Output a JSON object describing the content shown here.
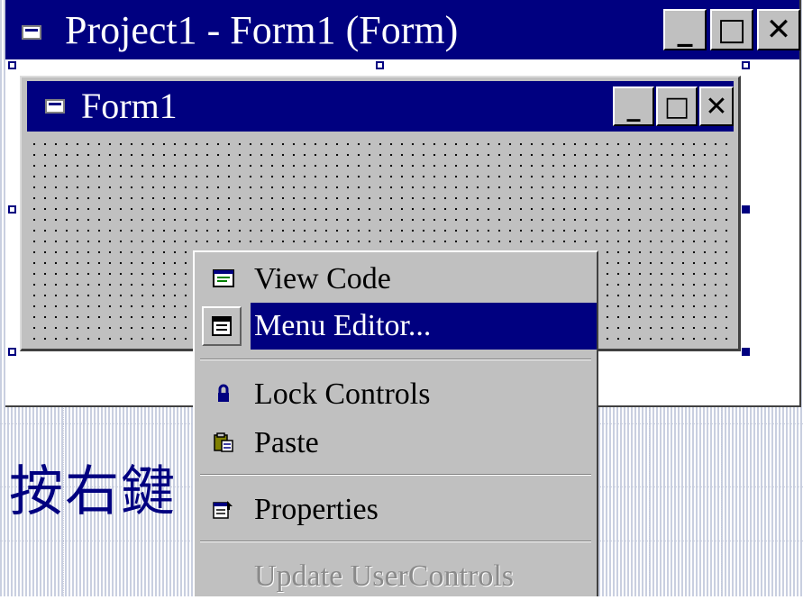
{
  "outer_window": {
    "title": "Project1 - Form1 (Form)",
    "buttons": {
      "minimize": "_",
      "maximize": "□",
      "close": "✕"
    }
  },
  "form": {
    "title": "Form1",
    "buttons": {
      "minimize": "_",
      "maximize": "□",
      "close": "✕"
    }
  },
  "context_menu": {
    "items": [
      {
        "label": "View Code",
        "icon": "code-window-icon",
        "state": "normal"
      },
      {
        "label": "Menu Editor...",
        "icon": "menu-editor-icon",
        "state": "selected"
      },
      {
        "label": "Lock Controls",
        "icon": "lock-icon",
        "state": "normal"
      },
      {
        "label": "Paste",
        "icon": "paste-icon",
        "state": "normal"
      },
      {
        "label": "Properties",
        "icon": "properties-icon",
        "state": "normal"
      },
      {
        "label": "Update UserControls",
        "icon": "",
        "state": "disabled"
      }
    ]
  },
  "annotation": {
    "text": "按右鍵"
  },
  "colors": {
    "titlebar": "#000080",
    "face": "#c0c0c0",
    "highlight": "#000080"
  }
}
